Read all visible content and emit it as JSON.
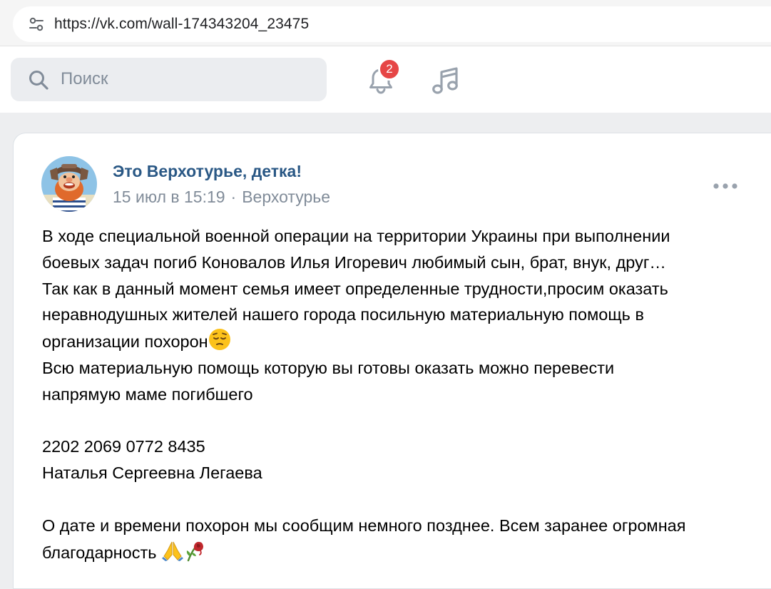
{
  "browser": {
    "url": "https://vk.com/wall-174343204_23475",
    "site_settings_icon": "tune-icon"
  },
  "header": {
    "search": {
      "placeholder": "Поиск",
      "icon": "search-icon"
    },
    "notifications": {
      "icon": "bell-icon",
      "badge_count": "2",
      "badge_color": "#e64646"
    },
    "music": {
      "icon": "music-note-icon"
    }
  },
  "post": {
    "author": "Это Верхотурье, детка!",
    "date": "15 июл в 15:19",
    "separator": "·",
    "location": "Верхотурье",
    "more_icon": "more-horizontal-icon",
    "lines": [
      "В ходе специальной военной операции на территории Украины при выполнении",
      "боевых задач погиб Коновалов Илья Игоревич любимый сын, брат, внук, друг…",
      "Так как в данный момент семья имеет определенные трудности,просим оказать",
      "неравнодушных жителей нашего города посильную материальную помощь в",
      "организации похорон",
      "Всю материальную помощь которую вы готовы оказать можно перевести",
      "напрямую маме погибшего",
      "",
      "2202 2069 0772 8435",
      "Наталья Сергеевна Легаева",
      "",
      "О дате и времени похорон мы сообщим немного позднее. Всем заранее огромная",
      "благодарность "
    ],
    "emoji": {
      "pensive": "pensive-face-emoji",
      "pray": "folded-hands-emoji",
      "rose": "wilted-flower-emoji"
    }
  },
  "colors": {
    "link": "#2a5885",
    "muted": "#818c99",
    "page_bg": "#edeef0",
    "badge": "#e64646"
  }
}
